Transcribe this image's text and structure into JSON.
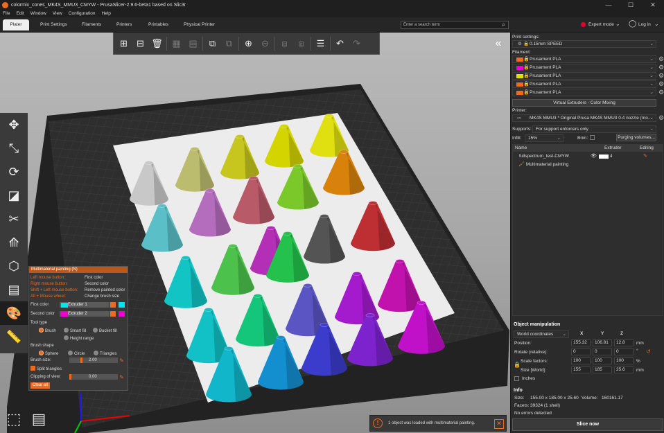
{
  "window": {
    "title": "colormix_cones_MK4S_MMU3_CMYW - PrusaSlicer-2.9.6-beta1 based on Slic3r",
    "minimize_glyph": "—",
    "maximize_glyph": "☐",
    "close_glyph": "✕"
  },
  "menu": [
    "File",
    "Edit",
    "Window",
    "View",
    "Configuration",
    "Help"
  ],
  "tabs": [
    "Plater",
    "Print Settings",
    "Filaments",
    "Printers",
    "Printables",
    "Physical Printer"
  ],
  "search": {
    "placeholder": "Enter a search term"
  },
  "mode": {
    "label": "Expert mode",
    "login": "Log in",
    "dot_color": "#e4002b"
  },
  "toolbar_icons": [
    "add-icon",
    "delete-icon",
    "delete-all-icon",
    "arrange-icon",
    "arrange-selection-icon",
    "copy-icon",
    "paste-icon",
    "add-instance-icon",
    "remove-instance-icon",
    "split-objects-icon",
    "split-parts-icon",
    "variable-layer-height-icon",
    "undo-icon",
    "redo-icon"
  ],
  "left_tools": [
    "move-icon",
    "scale-icon",
    "rotate-icon",
    "place-on-face-icon",
    "cut-icon",
    "support-painting-icon",
    "seam-painting-icon",
    "fuzzy-skin-icon",
    "multimaterial-painting-icon",
    "measure-icon"
  ],
  "paint_panel": {
    "title": "Multimaterial painting (N)",
    "hints": [
      {
        "key": "Left mouse button:",
        "action": "First color"
      },
      {
        "key": "Right mouse button:",
        "action": "Second color"
      },
      {
        "key": "Shift + Left mouse button:",
        "action": "Remove painted color"
      },
      {
        "key": "Alt + Mouse wheel:",
        "action": "Change brush size"
      }
    ],
    "first_color_label": "First color",
    "first_color_value": "Extruder 1",
    "first_color_hex": "#00e5ee",
    "second_color_label": "Second color",
    "second_color_value": "Extruder 2",
    "second_color_hex": "#ee00d2",
    "tool_type_label": "Tool type",
    "tools": [
      "Brush",
      "Smart fill",
      "Bucket fill",
      "Height range"
    ],
    "brush_shape_label": "Brush shape",
    "shapes": [
      "Sphere",
      "Circle",
      "Triangles"
    ],
    "brush_size_label": "Brush size:",
    "brush_size_value": "2.00",
    "split_triangles_label": "Split triangles",
    "clipping_label": "Clipping of view:",
    "clipping_value": "0.00",
    "clear_all": "Clear all"
  },
  "notification": {
    "text": "1 object was loaded with multimaterial painting.",
    "icon_glyph": "!",
    "close_glyph": "✕"
  },
  "sidebar": {
    "print_settings_label": "Print settings:",
    "print_profile": "0.15mm SPEED",
    "filament_label": "Filament:",
    "filaments": [
      {
        "name": "Prusament PLA",
        "color": "#ed6b21"
      },
      {
        "name": "Prusament PLA",
        "color": "#ee00d2"
      },
      {
        "name": "Prusament PLA",
        "color": "#e0e000"
      },
      {
        "name": "Prusament PLA",
        "color": "#ed6b21"
      },
      {
        "name": "Prusament PLA",
        "color": "#ed6b21"
      }
    ],
    "virtual_extruders_button": "Virtual Extruders - Color Mixing",
    "printer_label": "Printer:",
    "printer_value": "MK4S MMU3 * Original Prusa MK4S MMU3 0.4 nozzle (mo...",
    "supports_label": "Supports:",
    "supports_value": "For support enforcers only",
    "infill_label": "Infill:",
    "infill_value": "15%",
    "brim_label": "Brim:",
    "purging_button": "Purging volumes...",
    "object_list": {
      "headers": [
        "Name",
        "Extruder",
        "Editing"
      ],
      "object_name": "fullspectrum_test-CMYW",
      "object_extruder": "4",
      "child_label": "Multimaterial painting"
    },
    "object_manipulation": {
      "title": "Object manipulation",
      "coord_system": "World coordinates",
      "axes": [
        "X",
        "Y",
        "Z"
      ],
      "position_label": "Position:",
      "position": [
        "155.32",
        "106.81",
        "12.8"
      ],
      "position_unit": "mm",
      "rotate_label": "Rotate (relative):",
      "rotate": [
        "0",
        "0",
        "0"
      ],
      "rotate_unit": "°",
      "scale_label": "Scale factors:",
      "scale": [
        "100",
        "100",
        "100"
      ],
      "scale_unit": "%",
      "size_label": "Size [World]:",
      "size": [
        "155",
        "185",
        "25.6"
      ],
      "size_unit": "mm",
      "inches_label": "Inches"
    },
    "info": {
      "title": "Info",
      "size_label": "Size:",
      "size_value": "155.00 x 185.00 x 25.60",
      "volume_label": "Volume:",
      "volume_value": "160161.17",
      "facets_label": "Facets:",
      "facets_value": "39324 (1 shell)",
      "errors": "No errors detected"
    },
    "slice_button": "Slice now"
  },
  "cones": [
    {
      "color": "#c8c8c8"
    },
    {
      "color": "#bcbc6e"
    },
    {
      "color": "#c6c61e"
    },
    {
      "color": "#d4d400"
    },
    {
      "color": "#e0df10"
    },
    {
      "color": "#5bbfc7"
    },
    {
      "color": "#b46dbd"
    },
    {
      "color": "#b85a68"
    },
    {
      "color": "#7bc82a"
    },
    {
      "color": "#d8820c"
    },
    {
      "color": "#b22fb6"
    },
    {
      "color": "#545454"
    },
    {
      "color": "#bd2f33"
    },
    {
      "color": "#12c4c4"
    },
    {
      "color": "#4cc24c"
    },
    {
      "color": "#24c24c"
    },
    {
      "color": "#11c1c5"
    },
    {
      "color": "#13c67a"
    },
    {
      "color": "#5a55c3"
    },
    {
      "color": "#a31bcc"
    },
    {
      "color": "#c212ad"
    },
    {
      "color": "#12b6ca"
    },
    {
      "color": "#138fd0"
    },
    {
      "color": "#3b3bcc"
    },
    {
      "color": "#7c23cd"
    },
    {
      "color": "#c010c8"
    }
  ]
}
